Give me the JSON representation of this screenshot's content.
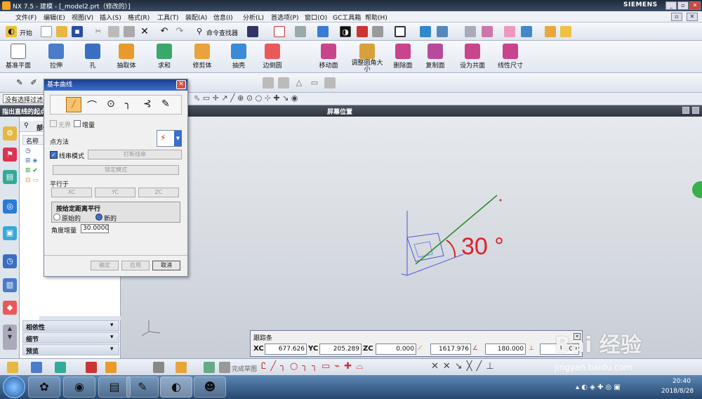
{
  "window": {
    "title": "NX 7.5 - 建模 - [_model2.prt（修改的）]",
    "brand": "SIEMENS"
  },
  "menu": [
    "文件(F)",
    "编辑(E)",
    "视图(V)",
    "插入(S)",
    "格式(R)",
    "工具(T)",
    "装配(A)",
    "信息(I)",
    "分析(L)",
    "首选项(P)",
    "窗口(O)",
    "GC工具箱",
    "帮助(H)"
  ],
  "toolbar1": {
    "start": "开始",
    "command_finder": "命令查找器"
  },
  "toolbar2": [
    "基准平面",
    "拉伸",
    "孔",
    "抽取体",
    "求和",
    "修剪体",
    "抽壳",
    "边倒圆",
    "移动面",
    "调整圆角大小",
    "删除面",
    "复制面",
    "设为共面",
    "线性尺寸"
  ],
  "selection": {
    "filter": "没有选择过滤器"
  },
  "status": {
    "prompt": "指出直线的起点",
    "view_label": "屏幕位置"
  },
  "nav": {
    "title": "部件导航器",
    "col_name": "名称",
    "sections": [
      "相依性",
      "细节",
      "预览"
    ]
  },
  "dialog": {
    "title": "基本曲线",
    "unbounded": "无界",
    "increment": "增量",
    "point_method": "点方法",
    "string_mode": "线串模式",
    "break_string": "打断线串",
    "lock_mode": "锁定模式",
    "parallel_to": "平行于",
    "xc": "XC",
    "yc": "YC",
    "zc": "ZC",
    "offset_title": "按给定距离平行",
    "original": "原始的",
    "new": "新的",
    "angle_inc_label": "角度增量",
    "angle_inc_value": "30.00000",
    "ok": "确定",
    "apply": "应用",
    "cancel": "取消"
  },
  "viewport": {
    "annotation": "30 °"
  },
  "tracker": {
    "title": "跟踪条",
    "xc_label": "XC",
    "xc": "677.626",
    "yc_label": "YC",
    "yc": "205.289",
    "zc_label": "ZC",
    "zc": "0.000",
    "length": "1617.976",
    "angle": "180.000",
    "offset": "1.000"
  },
  "bottom_toolbar": {
    "sketch": "完成草图"
  },
  "clock": {
    "time": "20:40",
    "date": "2018/8/28"
  },
  "watermark": {
    "text": "Bai 经验",
    "url": "jingyan.baidu.com"
  },
  "colors": {
    "accent": "#3a6ed0",
    "line": "#2e8b2e",
    "angle_text": "#e0202a"
  }
}
